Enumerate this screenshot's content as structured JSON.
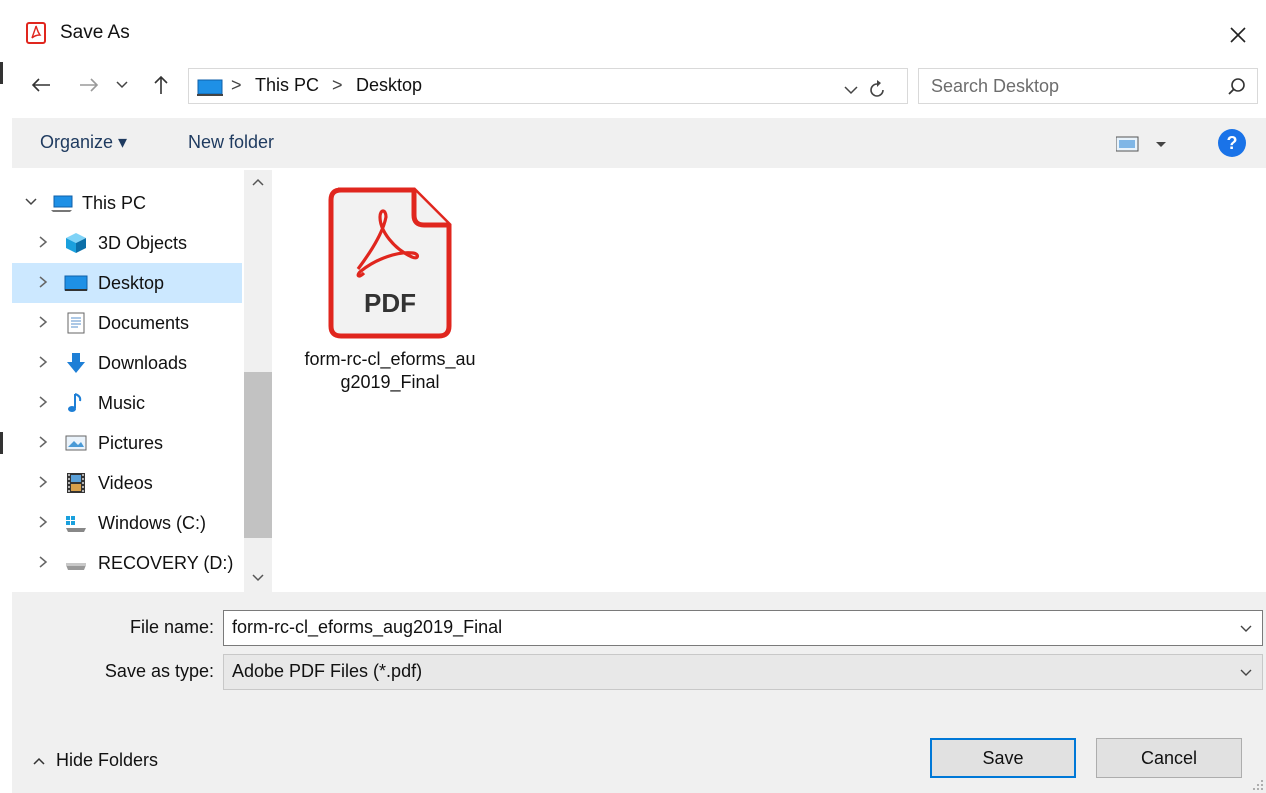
{
  "window": {
    "title": "Save As"
  },
  "address": {
    "segments": [
      "This PC",
      "Desktop"
    ],
    "separator": ">",
    "search_placeholder": "Search Desktop"
  },
  "toolbar": {
    "organize_label": "Organize ▾",
    "new_folder_label": "New folder",
    "help_label": "?"
  },
  "nav": {
    "items": [
      {
        "label": "This PC",
        "icon": "computer-icon",
        "expanded": true
      },
      {
        "label": "3D Objects",
        "icon": "cube-icon"
      },
      {
        "label": "Desktop",
        "icon": "desktop-icon",
        "selected": true
      },
      {
        "label": "Documents",
        "icon": "document-icon"
      },
      {
        "label": "Downloads",
        "icon": "download-arrow-icon"
      },
      {
        "label": "Music",
        "icon": "music-note-icon"
      },
      {
        "label": "Pictures",
        "icon": "picture-icon"
      },
      {
        "label": "Videos",
        "icon": "film-icon"
      },
      {
        "label": "Windows (C:)",
        "icon": "windows-drive-icon"
      },
      {
        "label": "RECOVERY (D:)",
        "icon": "drive-icon"
      }
    ]
  },
  "content": {
    "files": [
      {
        "name": "form-rc-cl_eforms_aug2019_Final",
        "icon_text": "PDF",
        "type": "pdf"
      }
    ]
  },
  "form": {
    "file_name_label": "File name:",
    "file_name_value": "form-rc-cl_eforms_aug2019_Final",
    "save_type_label": "Save as type:",
    "save_type_value": "Adobe PDF Files (*.pdf)"
  },
  "footer": {
    "hide_folders_label": "Hide Folders",
    "save_label": "Save",
    "cancel_label": "Cancel"
  },
  "colors": {
    "selection": "#cce8ff",
    "accent": "#0078d7",
    "pdf_red": "#e0261e",
    "help_blue": "#1a73e8"
  }
}
